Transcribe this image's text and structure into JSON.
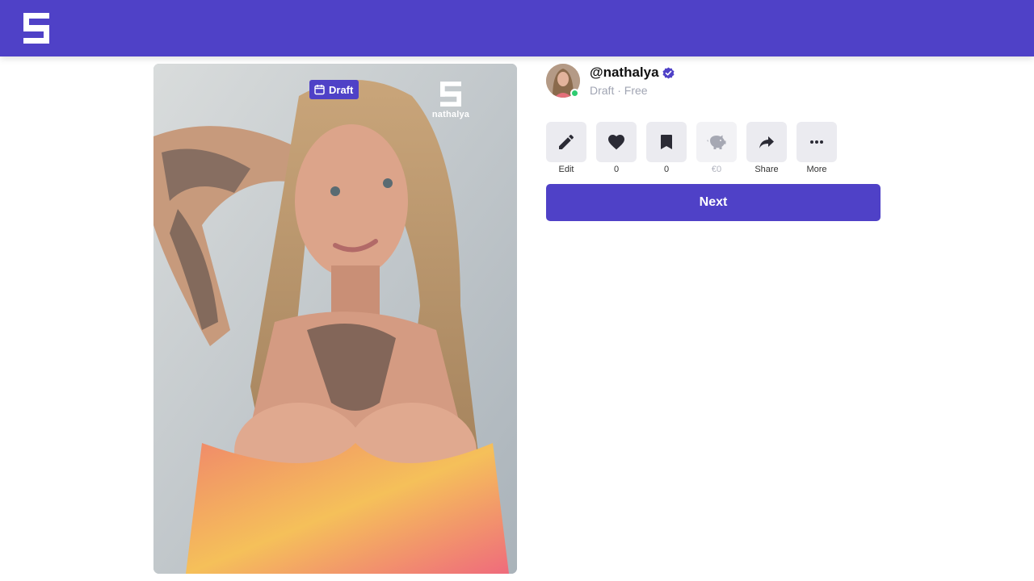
{
  "brand": {
    "accent": "#4f41c7",
    "logo_icon": "brand-logo-icon"
  },
  "media": {
    "badge_label": "Draft",
    "badge_icon": "calendar-edit-icon",
    "watermark_name": "nathalya"
  },
  "profile": {
    "username": "@nathalya",
    "verified_icon": "verified-badge-icon",
    "status_text": "Draft · Free",
    "online": true
  },
  "actions": {
    "edit": {
      "label": "Edit",
      "icon": "pencil-icon"
    },
    "likes": {
      "label": "0",
      "icon": "heart-icon"
    },
    "bookmarks": {
      "label": "0",
      "icon": "bookmark-icon"
    },
    "tips": {
      "label": "€0",
      "icon": "piggy-bank-icon"
    },
    "share": {
      "label": "Share",
      "icon": "share-arrow-icon"
    },
    "more": {
      "label": "More",
      "icon": "more-dots-icon"
    }
  },
  "next_button": {
    "label": "Next"
  }
}
